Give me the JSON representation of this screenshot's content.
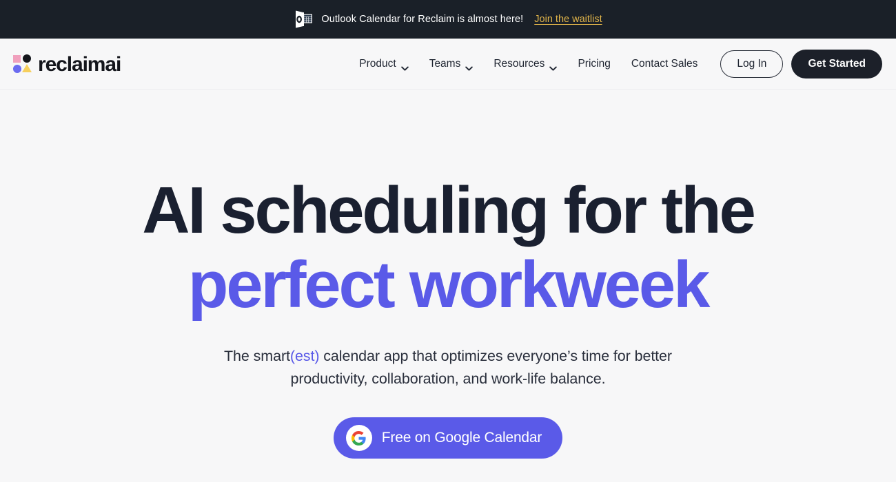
{
  "banner": {
    "icon": "outlook-calendar-icon",
    "text": "Outlook Calendar for Reclaim is almost here!",
    "link_label": "Join the waitlist",
    "background": "#1a2028",
    "link_color": "#e0b44a"
  },
  "header": {
    "logo": {
      "wordmark": "reclaimai",
      "mark_icon": "reclaim-logo-mark",
      "colors": {
        "square": "#f0a0bd",
        "dark_circle": "#14161c",
        "blue_circle": "#6b6bf0",
        "triangle": "#f6cf5d"
      }
    },
    "nav": [
      {
        "label": "Product",
        "has_dropdown": true,
        "icon": "chevron-down-icon"
      },
      {
        "label": "Teams",
        "has_dropdown": true,
        "icon": "chevron-down-icon"
      },
      {
        "label": "Resources",
        "has_dropdown": true,
        "icon": "chevron-down-icon"
      },
      {
        "label": "Pricing",
        "has_dropdown": false
      },
      {
        "label": "Contact Sales",
        "has_dropdown": false
      }
    ],
    "login_label": "Log In",
    "get_started_label": "Get Started"
  },
  "hero": {
    "headline_line1": "AI scheduling for the",
    "headline_line2": "perfect workweek",
    "headline_color": "#1a2030",
    "accent_color": "#5a5ae8",
    "subhead_part1": "The smart",
    "subhead_accent": "(est)",
    "subhead_part2": " calendar app that optimizes everyone’s time for better productivity, collaboration, and work-life balance.",
    "cta": {
      "label": "Free on Google Calendar",
      "icon": "google-g-icon",
      "background": "#5a5ae8"
    }
  },
  "page": {
    "background": "#f7f7f8"
  }
}
